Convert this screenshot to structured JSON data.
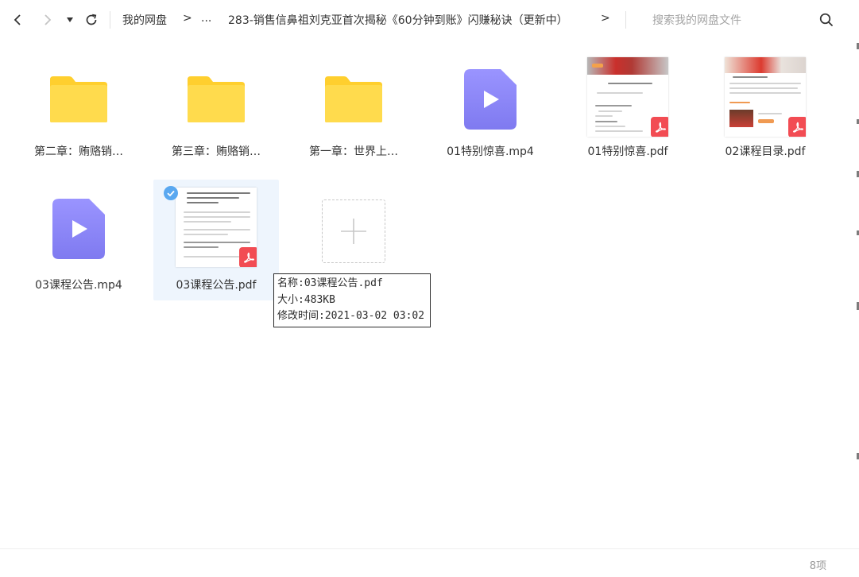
{
  "toolbar": {
    "back_icon": "chevron-left-icon",
    "forward_icon": "chevron-right-icon",
    "history_dropdown_icon": "caret-down-icon",
    "refresh_icon": "refresh-icon",
    "breadcrumb": {
      "root": "我的网盘",
      "separator": ">",
      "ellipsis": "...",
      "current": "283-销售信鼻祖刘克亚首次揭秘《60分钟到账》闪赚秘诀（更新中）",
      "trailing_separator": ">"
    },
    "search": {
      "placeholder": "搜索我的网盘文件",
      "value": ""
    }
  },
  "files": [
    {
      "name": "第二章：贿赂销…",
      "type": "folder"
    },
    {
      "name": "第三章：贿赂销…",
      "type": "folder"
    },
    {
      "name": "第一章：世界上…",
      "type": "folder"
    },
    {
      "name": "01特别惊喜.mp4",
      "type": "video"
    },
    {
      "name": "01特别惊喜.pdf",
      "type": "pdf"
    },
    {
      "name": "02课程目录.pdf",
      "type": "pdf"
    },
    {
      "name": "03课程公告.mp4",
      "type": "video"
    },
    {
      "name": "03课程公告.pdf",
      "type": "pdf",
      "selected": true
    }
  ],
  "tooltip": {
    "name_line": "名称:03课程公告.pdf",
    "size_line": "大小:483KB",
    "modified_line": "修改时间:2021-03-02 03:02"
  },
  "status": {
    "item_count": "8项"
  },
  "colors": {
    "folder": "#ffd43b",
    "video": "#8b87f7",
    "pdf_badge": "#f24c53",
    "selection": "#eef5fd",
    "check": "#5aa8f0"
  }
}
